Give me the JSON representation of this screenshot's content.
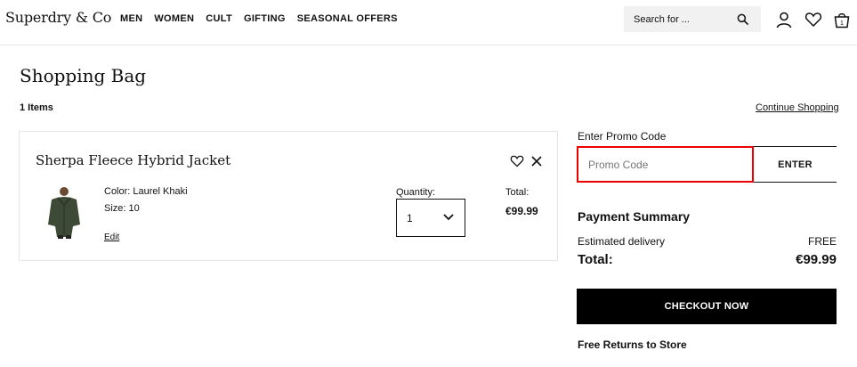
{
  "header": {
    "logo": "Superdry & Co",
    "nav": [
      "MEN",
      "WOMEN",
      "CULT",
      "GIFTING",
      "SEASONAL OFFERS"
    ],
    "search_placeholder": "Search for ...",
    "icons": [
      "search-icon",
      "account-icon",
      "wishlist-icon",
      "bag-icon"
    ],
    "bag_count": "1"
  },
  "page": {
    "title": "Shopping Bag",
    "items_count": "1 Items",
    "continue_shopping": "Continue Shopping"
  },
  "product": {
    "name": "Sherpa Fleece Hybrid Jacket",
    "color": "Color: Laurel Khaki",
    "size": "Size: 10",
    "edit": "Edit",
    "quantity_label": "Quantity:",
    "quantity_value": "1",
    "total_label": "Total:",
    "total_value": "€99.99"
  },
  "promo": {
    "label": "Enter Promo Code",
    "placeholder": "Promo Code",
    "button": "ENTER"
  },
  "summary": {
    "title": "Payment Summary",
    "delivery_label": "Estimated delivery",
    "delivery_value": "FREE",
    "total_label": "Total:",
    "total_value": "€99.99",
    "checkout": "CHECKOUT NOW",
    "returns": "Free Returns to Store"
  },
  "colors": {
    "highlight": "#ee0000",
    "checkout_bg": "#000000",
    "jacket": "#3d4a36"
  }
}
